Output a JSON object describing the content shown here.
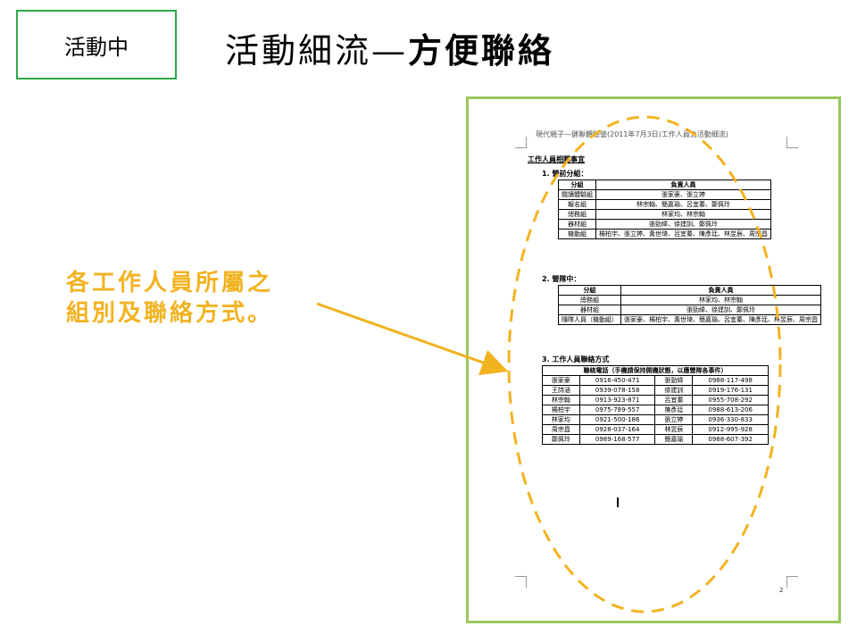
{
  "tag_label": "活動中",
  "title": {
    "part1": "活動細流—",
    "part2": "方便聯絡"
  },
  "callout": {
    "line1": "各工作人員所屬之",
    "line2": "組別及聯絡方式。"
  },
  "doc": {
    "header": "現代親子—健聯體驗營(2011年7月3日)工作人員之活動細流)",
    "sec_title": "工作人員相關事宜",
    "part1_label": "1. 營前分組：",
    "table1": {
      "headers": [
        "分組",
        "負責人員"
      ],
      "rows": [
        [
          "閱讀體驗組",
          "張家豪、張立婷"
        ],
        [
          "報名組",
          "林宗翰、簡嘉瑜、呂宜蓁、鄭佩玲"
        ],
        [
          "總務組",
          "林家均、林宗翰"
        ],
        [
          "器材組",
          "張勁緯、徐建訓、鄭佩玲"
        ],
        [
          "機動組",
          "楊柏宇、張立婷、黃世琦、呂宜蓁、陳彥廷、林昱辰、周宗昌"
        ]
      ]
    },
    "part2_label": "2. 營隊中：",
    "table2": {
      "headers": [
        "分組",
        "負責人員"
      ],
      "rows": [
        [
          "總務組",
          "林家均、林宗翰"
        ],
        [
          "器材組",
          "張勁緯、徐建訓、鄭佩玲"
        ],
        [
          "隨隊人員（機動組）",
          "張家豪、楊柏宇、黃世琦、簡嘉瑜、呂宜蓁、陳彥廷、林昱辰、周宗昌"
        ]
      ]
    },
    "part3_label": "3. 工作人員聯絡方式",
    "table3": {
      "caption": "聯絡電話（手機請保持開機狀態，以應營隊各事件）",
      "rows": [
        [
          "張家豪",
          "0916-450-471",
          "張勁緯",
          "0988-117-498"
        ],
        [
          "王詩涵",
          "0939-078-158",
          "徐建訓",
          "0919-176-131"
        ],
        [
          "林宗翰",
          "0913-923-871",
          "呂宜蓁",
          "0955-708-292"
        ],
        [
          "楊柏宇",
          "0975-789-557",
          "陳彥廷",
          "0988-613-206"
        ],
        [
          "林家均",
          "0921-500-186",
          "張立婷",
          "0936-330-833"
        ],
        [
          "周宗昌",
          "0928-037-164",
          "林昱辰",
          "0912-995-928"
        ],
        [
          "鄭佩玲",
          "0989-168-577",
          "簡嘉瑜",
          "0988-607-392"
        ]
      ]
    },
    "page_number": "2"
  },
  "colors": {
    "tag_border": "#2ea84a",
    "frame_border": "#9bc75d",
    "accent": "#f2b321"
  }
}
